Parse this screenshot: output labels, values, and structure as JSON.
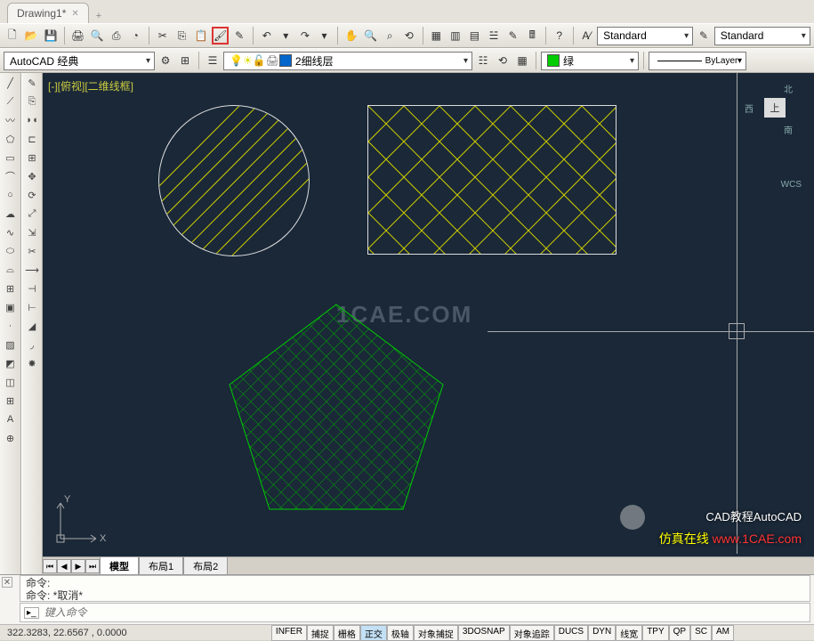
{
  "tab": {
    "name": "Drawing1*"
  },
  "toolbar1": {
    "text_style_label": "Standard",
    "text_style2_label": "Standard"
  },
  "toolbar2": {
    "workspace": "AutoCAD 经典",
    "layer": "2细线层",
    "color_label": "绿",
    "linetype_label": "ByLayer"
  },
  "viewport": {
    "topleft_label": "[-][俯视][二维线框]",
    "watermark": "1CAE.COM",
    "navcube": {
      "top": "上",
      "north": "北",
      "west": "西",
      "south": "南"
    },
    "wcs": "WCS",
    "ucs": {
      "x": "X",
      "y": "Y"
    }
  },
  "modeltabs": {
    "model": "模型",
    "layout1": "布局1",
    "layout2": "布局2"
  },
  "command": {
    "hist1": "命令:",
    "hist2": "命令: *取消*",
    "prompt_icon": "▸",
    "placeholder": "键入命令"
  },
  "status": {
    "coords": "322.3283, 22.6567 , 0.0000",
    "toggles": [
      "INFER",
      "捕捉",
      "栅格",
      "正交",
      "极轴",
      "对象捕捉",
      "3DOSNAP",
      "对象追踪",
      "DUCS",
      "DYN",
      "线宽",
      "TPY",
      "QP",
      "SC",
      "AM"
    ]
  },
  "corner": {
    "line1": "CAD教程AutoCAD",
    "line2a": "仿真在线",
    "line2b": "www.1CAE.com"
  },
  "chart_data": {
    "type": "diagram",
    "shapes": [
      {
        "kind": "circle",
        "hatch": "diagonal-lines",
        "hatch_color": "#cccc00",
        "outline": "#dddddd"
      },
      {
        "kind": "rectangle",
        "hatch": "diamond-crosshatch",
        "hatch_color": "#cccc00",
        "outline": "#dddddd"
      },
      {
        "kind": "pentagon",
        "hatch": "dense-crosshatch",
        "hatch_color": "#00aa00",
        "outline": "#00cc00"
      }
    ]
  }
}
